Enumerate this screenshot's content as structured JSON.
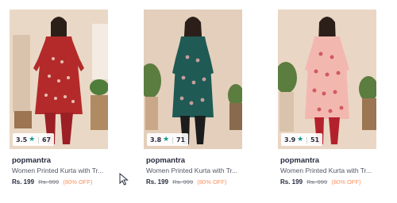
{
  "products": [
    {
      "brand": "popmantra",
      "title": "Women Printed Kurta with Tr...",
      "rating": "3.5",
      "rating_count": "67",
      "price": "Rs. 199",
      "mrp": "Rs. 999",
      "discount": "(80% OFF)",
      "kurta_color": "#b42a2a",
      "pattern_color": "#f1d9c8",
      "pant_color": "#9b1f24",
      "bg_color": "#ead8c6"
    },
    {
      "brand": "popmantra",
      "title": "Women Printed Kurta with Tr...",
      "rating": "3.8",
      "rating_count": "71",
      "price": "Rs. 199",
      "mrp": "Rs. 999",
      "discount": "(80% OFF)",
      "kurta_color": "#1f5a55",
      "pattern_color": "#d7a6a2",
      "pant_color": "#1c1c1c",
      "bg_color": "#e3cfbb"
    },
    {
      "brand": "popmantra",
      "title": "Women Printed Kurta with Tr...",
      "rating": "3.9",
      "rating_count": "51",
      "price": "Rs. 199",
      "mrp": "Rs. 999",
      "discount": "(80% OFF)",
      "kurta_color": "#f2b8b0",
      "pattern_color": "#c9434f",
      "pant_color": "#b3222c",
      "bg_color": "#ead6c4"
    }
  ],
  "icons": {
    "rating_star": "star-icon",
    "cursor": "mouse-pointer-icon"
  }
}
